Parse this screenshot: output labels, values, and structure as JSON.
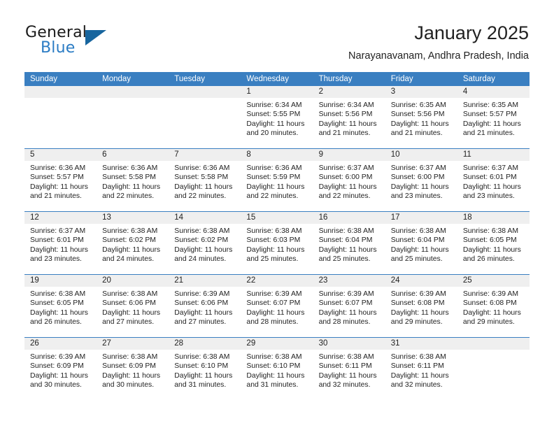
{
  "brand": {
    "name_part1": "General",
    "name_part2": "Blue",
    "logo_icon": "triangle-logo-icon",
    "accent_color": "#2b7cc4",
    "logo_color": "#17659e"
  },
  "header": {
    "title": "January 2025",
    "location": "Narayanavanam, Andhra Pradesh, India"
  },
  "calendar": {
    "header_bg_color": "#3a7fc1",
    "daynum_bg_color": "#efefef",
    "weekdays": [
      "Sunday",
      "Monday",
      "Tuesday",
      "Wednesday",
      "Thursday",
      "Friday",
      "Saturday"
    ],
    "labels": {
      "sunrise": "Sunrise:",
      "sunset": "Sunset:",
      "daylight": "Daylight:"
    },
    "weeks": [
      [
        {
          "day": "",
          "empty": true,
          "sunrise": "",
          "sunset": "",
          "daylight_line1": "",
          "daylight_line2": ""
        },
        {
          "day": "",
          "empty": true,
          "sunrise": "",
          "sunset": "",
          "daylight_line1": "",
          "daylight_line2": ""
        },
        {
          "day": "",
          "empty": true,
          "sunrise": "",
          "sunset": "",
          "daylight_line1": "",
          "daylight_line2": ""
        },
        {
          "day": "1",
          "empty": false,
          "sunrise": "Sunrise: 6:34 AM",
          "sunset": "Sunset: 5:55 PM",
          "daylight_line1": "Daylight: 11 hours",
          "daylight_line2": "and 20 minutes."
        },
        {
          "day": "2",
          "empty": false,
          "sunrise": "Sunrise: 6:34 AM",
          "sunset": "Sunset: 5:56 PM",
          "daylight_line1": "Daylight: 11 hours",
          "daylight_line2": "and 21 minutes."
        },
        {
          "day": "3",
          "empty": false,
          "sunrise": "Sunrise: 6:35 AM",
          "sunset": "Sunset: 5:56 PM",
          "daylight_line1": "Daylight: 11 hours",
          "daylight_line2": "and 21 minutes."
        },
        {
          "day": "4",
          "empty": false,
          "sunrise": "Sunrise: 6:35 AM",
          "sunset": "Sunset: 5:57 PM",
          "daylight_line1": "Daylight: 11 hours",
          "daylight_line2": "and 21 minutes."
        }
      ],
      [
        {
          "day": "5",
          "empty": false,
          "sunrise": "Sunrise: 6:36 AM",
          "sunset": "Sunset: 5:57 PM",
          "daylight_line1": "Daylight: 11 hours",
          "daylight_line2": "and 21 minutes."
        },
        {
          "day": "6",
          "empty": false,
          "sunrise": "Sunrise: 6:36 AM",
          "sunset": "Sunset: 5:58 PM",
          "daylight_line1": "Daylight: 11 hours",
          "daylight_line2": "and 22 minutes."
        },
        {
          "day": "7",
          "empty": false,
          "sunrise": "Sunrise: 6:36 AM",
          "sunset": "Sunset: 5:58 PM",
          "daylight_line1": "Daylight: 11 hours",
          "daylight_line2": "and 22 minutes."
        },
        {
          "day": "8",
          "empty": false,
          "sunrise": "Sunrise: 6:36 AM",
          "sunset": "Sunset: 5:59 PM",
          "daylight_line1": "Daylight: 11 hours",
          "daylight_line2": "and 22 minutes."
        },
        {
          "day": "9",
          "empty": false,
          "sunrise": "Sunrise: 6:37 AM",
          "sunset": "Sunset: 6:00 PM",
          "daylight_line1": "Daylight: 11 hours",
          "daylight_line2": "and 22 minutes."
        },
        {
          "day": "10",
          "empty": false,
          "sunrise": "Sunrise: 6:37 AM",
          "sunset": "Sunset: 6:00 PM",
          "daylight_line1": "Daylight: 11 hours",
          "daylight_line2": "and 23 minutes."
        },
        {
          "day": "11",
          "empty": false,
          "sunrise": "Sunrise: 6:37 AM",
          "sunset": "Sunset: 6:01 PM",
          "daylight_line1": "Daylight: 11 hours",
          "daylight_line2": "and 23 minutes."
        }
      ],
      [
        {
          "day": "12",
          "empty": false,
          "sunrise": "Sunrise: 6:37 AM",
          "sunset": "Sunset: 6:01 PM",
          "daylight_line1": "Daylight: 11 hours",
          "daylight_line2": "and 23 minutes."
        },
        {
          "day": "13",
          "empty": false,
          "sunrise": "Sunrise: 6:38 AM",
          "sunset": "Sunset: 6:02 PM",
          "daylight_line1": "Daylight: 11 hours",
          "daylight_line2": "and 24 minutes."
        },
        {
          "day": "14",
          "empty": false,
          "sunrise": "Sunrise: 6:38 AM",
          "sunset": "Sunset: 6:02 PM",
          "daylight_line1": "Daylight: 11 hours",
          "daylight_line2": "and 24 minutes."
        },
        {
          "day": "15",
          "empty": false,
          "sunrise": "Sunrise: 6:38 AM",
          "sunset": "Sunset: 6:03 PM",
          "daylight_line1": "Daylight: 11 hours",
          "daylight_line2": "and 25 minutes."
        },
        {
          "day": "16",
          "empty": false,
          "sunrise": "Sunrise: 6:38 AM",
          "sunset": "Sunset: 6:04 PM",
          "daylight_line1": "Daylight: 11 hours",
          "daylight_line2": "and 25 minutes."
        },
        {
          "day": "17",
          "empty": false,
          "sunrise": "Sunrise: 6:38 AM",
          "sunset": "Sunset: 6:04 PM",
          "daylight_line1": "Daylight: 11 hours",
          "daylight_line2": "and 25 minutes."
        },
        {
          "day": "18",
          "empty": false,
          "sunrise": "Sunrise: 6:38 AM",
          "sunset": "Sunset: 6:05 PM",
          "daylight_line1": "Daylight: 11 hours",
          "daylight_line2": "and 26 minutes."
        }
      ],
      [
        {
          "day": "19",
          "empty": false,
          "sunrise": "Sunrise: 6:38 AM",
          "sunset": "Sunset: 6:05 PM",
          "daylight_line1": "Daylight: 11 hours",
          "daylight_line2": "and 26 minutes."
        },
        {
          "day": "20",
          "empty": false,
          "sunrise": "Sunrise: 6:38 AM",
          "sunset": "Sunset: 6:06 PM",
          "daylight_line1": "Daylight: 11 hours",
          "daylight_line2": "and 27 minutes."
        },
        {
          "day": "21",
          "empty": false,
          "sunrise": "Sunrise: 6:39 AM",
          "sunset": "Sunset: 6:06 PM",
          "daylight_line1": "Daylight: 11 hours",
          "daylight_line2": "and 27 minutes."
        },
        {
          "day": "22",
          "empty": false,
          "sunrise": "Sunrise: 6:39 AM",
          "sunset": "Sunset: 6:07 PM",
          "daylight_line1": "Daylight: 11 hours",
          "daylight_line2": "and 28 minutes."
        },
        {
          "day": "23",
          "empty": false,
          "sunrise": "Sunrise: 6:39 AM",
          "sunset": "Sunset: 6:07 PM",
          "daylight_line1": "Daylight: 11 hours",
          "daylight_line2": "and 28 minutes."
        },
        {
          "day": "24",
          "empty": false,
          "sunrise": "Sunrise: 6:39 AM",
          "sunset": "Sunset: 6:08 PM",
          "daylight_line1": "Daylight: 11 hours",
          "daylight_line2": "and 29 minutes."
        },
        {
          "day": "25",
          "empty": false,
          "sunrise": "Sunrise: 6:39 AM",
          "sunset": "Sunset: 6:08 PM",
          "daylight_line1": "Daylight: 11 hours",
          "daylight_line2": "and 29 minutes."
        }
      ],
      [
        {
          "day": "26",
          "empty": false,
          "sunrise": "Sunrise: 6:39 AM",
          "sunset": "Sunset: 6:09 PM",
          "daylight_line1": "Daylight: 11 hours",
          "daylight_line2": "and 30 minutes."
        },
        {
          "day": "27",
          "empty": false,
          "sunrise": "Sunrise: 6:38 AM",
          "sunset": "Sunset: 6:09 PM",
          "daylight_line1": "Daylight: 11 hours",
          "daylight_line2": "and 30 minutes."
        },
        {
          "day": "28",
          "empty": false,
          "sunrise": "Sunrise: 6:38 AM",
          "sunset": "Sunset: 6:10 PM",
          "daylight_line1": "Daylight: 11 hours",
          "daylight_line2": "and 31 minutes."
        },
        {
          "day": "29",
          "empty": false,
          "sunrise": "Sunrise: 6:38 AM",
          "sunset": "Sunset: 6:10 PM",
          "daylight_line1": "Daylight: 11 hours",
          "daylight_line2": "and 31 minutes."
        },
        {
          "day": "30",
          "empty": false,
          "sunrise": "Sunrise: 6:38 AM",
          "sunset": "Sunset: 6:11 PM",
          "daylight_line1": "Daylight: 11 hours",
          "daylight_line2": "and 32 minutes."
        },
        {
          "day": "31",
          "empty": false,
          "sunrise": "Sunrise: 6:38 AM",
          "sunset": "Sunset: 6:11 PM",
          "daylight_line1": "Daylight: 11 hours",
          "daylight_line2": "and 32 minutes."
        },
        {
          "day": "",
          "empty": true,
          "sunrise": "",
          "sunset": "",
          "daylight_line1": "",
          "daylight_line2": ""
        }
      ]
    ]
  }
}
